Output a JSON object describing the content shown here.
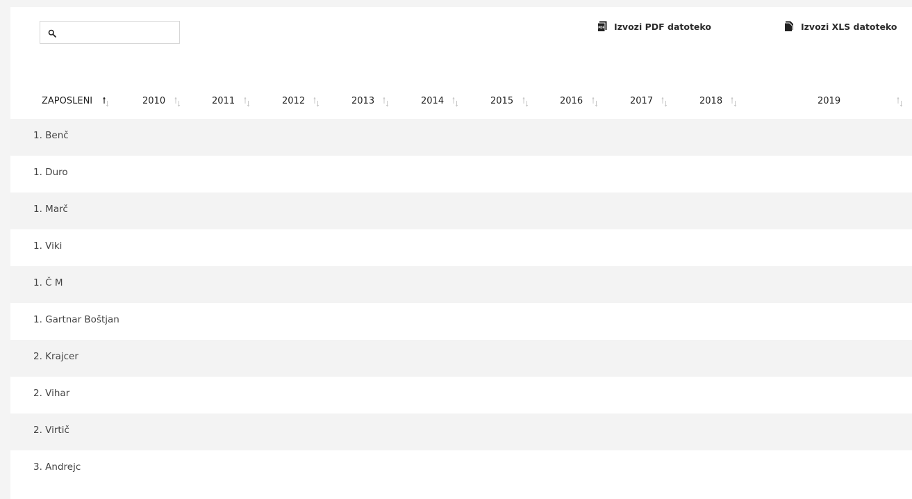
{
  "search": {
    "value": "",
    "placeholder": ""
  },
  "toolbar": {
    "export_pdf_label": "Izvozi PDF datoteko",
    "export_xls_label": "Izvozi XLS datoteko"
  },
  "table": {
    "columns": [
      "ZAPOSLENI",
      "2010",
      "2011",
      "2012",
      "2013",
      "2014",
      "2015",
      "2016",
      "2017",
      "2018",
      "2019"
    ],
    "sorted_column": "ZAPOSLENI",
    "sort_direction": "ascending",
    "rows": [
      {
        "name": "1. Benč"
      },
      {
        "name": "1. Duro"
      },
      {
        "name": "1. Marč"
      },
      {
        "name": "1. Viki"
      },
      {
        "name": "1. Č M"
      },
      {
        "name": "1. Gartnar Boštjan"
      },
      {
        "name": "2. Krajcer"
      },
      {
        "name": "2. Vihar"
      },
      {
        "name": "2. Virtič"
      },
      {
        "name": "3. Andrejc"
      }
    ]
  },
  "colors": {
    "row_stripe": "#f3f3f3",
    "row_plain": "#ffffff",
    "sort_inactive": "#bdbdbd",
    "sort_active": "#222222"
  }
}
